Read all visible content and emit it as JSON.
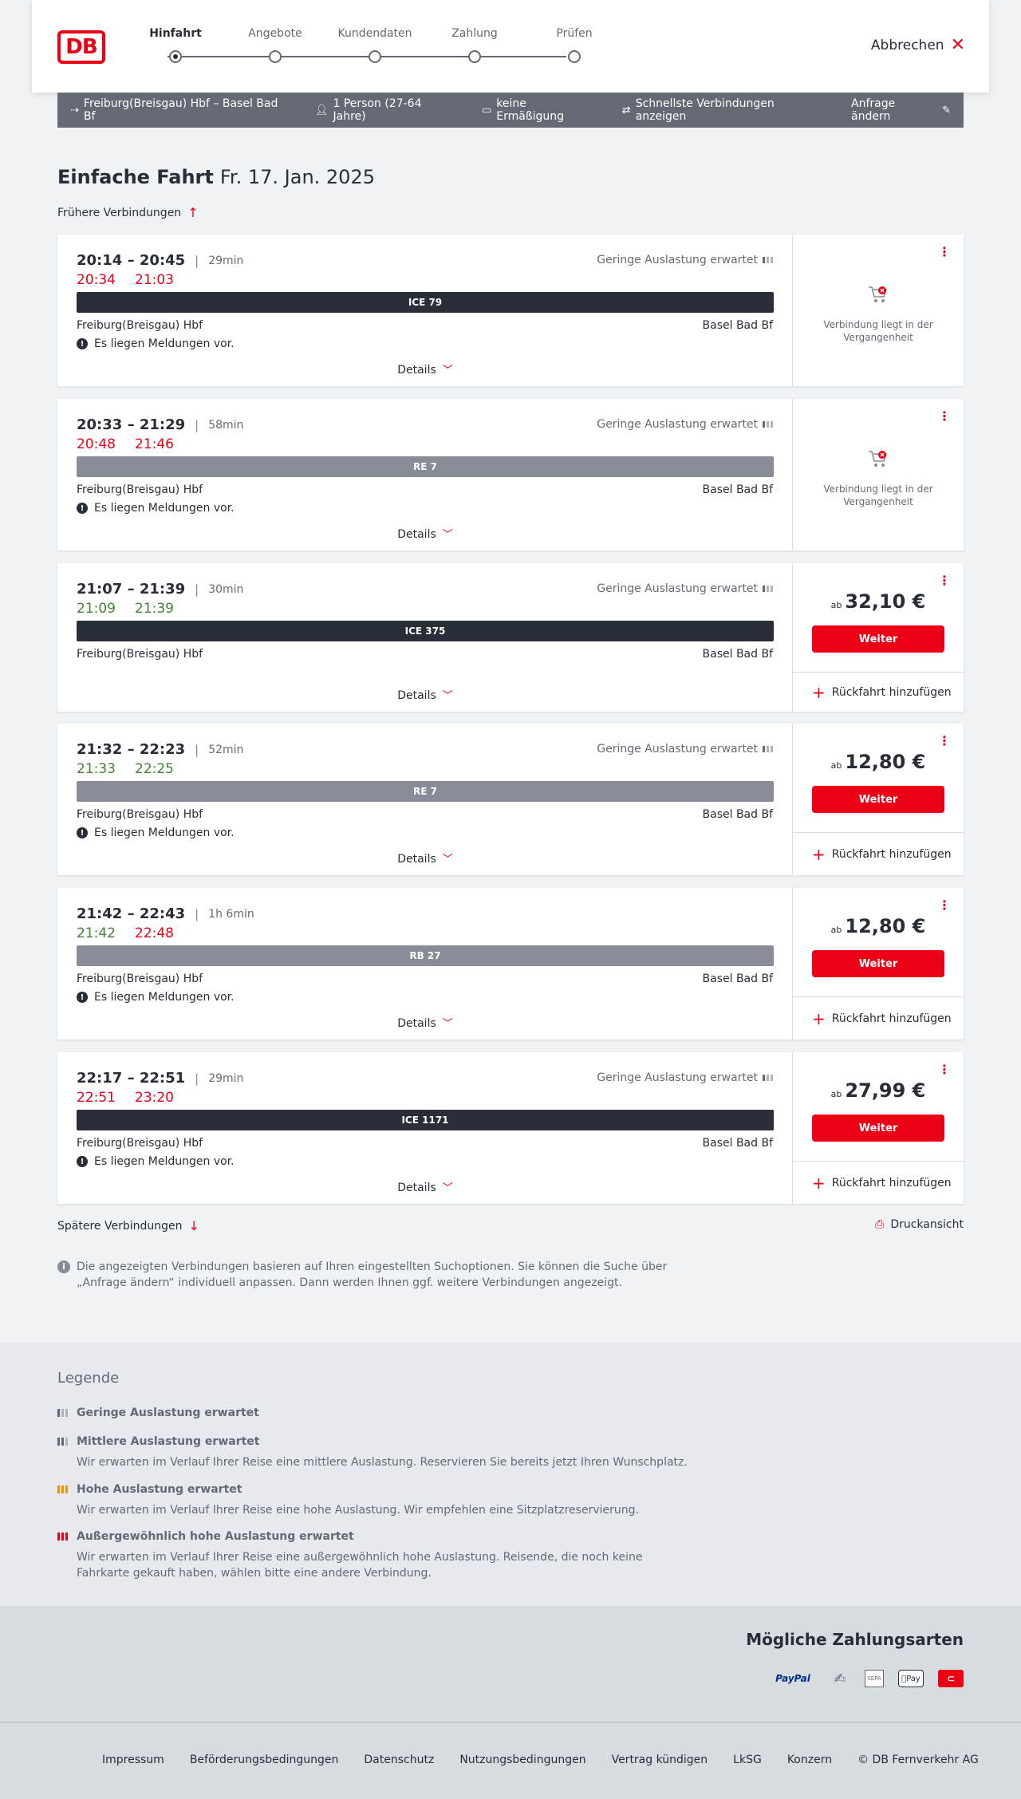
{
  "header": {
    "logo": "DB",
    "steps": [
      {
        "label": "Hinfahrt",
        "active": true
      },
      {
        "label": "Angebote",
        "active": false
      },
      {
        "label": "Kundendaten",
        "active": false
      },
      {
        "label": "Zahlung",
        "active": false
      },
      {
        "label": "Prüfen",
        "active": false
      }
    ],
    "cancel_label": "Abbrechen"
  },
  "summary": {
    "route": "Freiburg(Breisgau) Hbf – Basel Bad Bf",
    "travellers": "1 Person (27-64 Jahre)",
    "discount": "keine Ermäßigung",
    "fastest": "Schnellste Verbindungen anzeigen",
    "change": "Anfrage ändern"
  },
  "heading": {
    "title": "Einfache Fahrt",
    "date": "Fr. 17. Jan. 2025",
    "earlier": "Frühere Verbindungen",
    "later": "Spätere Verbindungen",
    "print": "Druckansicht"
  },
  "connections": [
    {
      "times": "20:14 – 20:45",
      "duration": "29min",
      "rt_dep": "20:34",
      "rt_arr": "21:03",
      "dep_status": "late",
      "arr_status": "late",
      "load": "Geringe Auslastung erwartet",
      "train": "ICE 79",
      "train_type": "ice",
      "from": "Freiburg(Breisgau) Hbf",
      "to": "Basel Bad Bf",
      "notice": "Es liegen Meldungen vor.",
      "details": "Details",
      "past": "Verbindung liegt in der Vergangenheit"
    },
    {
      "times": "20:33 – 21:29",
      "duration": "58min",
      "rt_dep": "20:48",
      "rt_arr": "21:46",
      "dep_status": "late",
      "arr_status": "late",
      "load": "Geringe Auslastung erwartet",
      "train": "RE 7",
      "train_type": "reg",
      "from": "Freiburg(Breisgau) Hbf",
      "to": "Basel Bad Bf",
      "notice": "Es liegen Meldungen vor.",
      "details": "Details",
      "past": "Verbindung liegt in der Vergangenheit"
    },
    {
      "times": "21:07 – 21:39",
      "duration": "30min",
      "rt_dep": "21:09",
      "rt_arr": "21:39",
      "dep_status": "ontime",
      "arr_status": "ontime",
      "load": "Geringe Auslastung erwartet",
      "train": "ICE 375",
      "train_type": "ice",
      "from": "Freiburg(Breisgau) Hbf",
      "to": "Basel Bad Bf",
      "details": "Details",
      "price_prefix": "ab",
      "price": "32,10 €",
      "button": "Weiter",
      "return": "Rückfahrt hinzufügen"
    },
    {
      "times": "21:32 – 22:23",
      "duration": "52min",
      "rt_dep": "21:33",
      "rt_arr": "22:25",
      "dep_status": "ontime",
      "arr_status": "ontime",
      "load": "Geringe Auslastung erwartet",
      "train": "RE 7",
      "train_type": "reg",
      "from": "Freiburg(Breisgau) Hbf",
      "to": "Basel Bad Bf",
      "notice": "Es liegen Meldungen vor.",
      "details": "Details",
      "price_prefix": "ab",
      "price": "12,80 €",
      "button": "Weiter",
      "return": "Rückfahrt hinzufügen"
    },
    {
      "times": "21:42 – 22:43",
      "duration": "1h 6min",
      "rt_dep": "21:42",
      "rt_arr": "22:48",
      "dep_status": "ontime",
      "arr_status": "late",
      "load": "",
      "train": "RB 27",
      "train_type": "reg",
      "from": "Freiburg(Breisgau) Hbf",
      "to": "Basel Bad Bf",
      "notice": "Es liegen Meldungen vor.",
      "details": "Details",
      "price_prefix": "ab",
      "price": "12,80 €",
      "button": "Weiter",
      "return": "Rückfahrt hinzufügen"
    },
    {
      "times": "22:17 – 22:51",
      "duration": "29min",
      "rt_dep": "22:51",
      "rt_arr": "23:20",
      "dep_status": "late",
      "arr_status": "late",
      "load": "Geringe Auslastung erwartet",
      "train": "ICE 1171",
      "train_type": "ice",
      "from": "Freiburg(Breisgau) Hbf",
      "to": "Basel Bad Bf",
      "notice": "Es liegen Meldungen vor.",
      "details": "Details",
      "price_prefix": "ab",
      "price": "27,99 €",
      "button": "Weiter",
      "return": "Rückfahrt hinzufügen"
    }
  ],
  "info_text": "Die angezeigten Verbindungen basieren auf Ihren eingestellten Suchoptionen. Sie können die Suche über „Anfrage ändern“ individuell anpassen. Dann werden Ihnen ggf. weitere Verbindungen angezeigt.",
  "legend": {
    "title": "Legende",
    "items": [
      {
        "title": "Geringe Auslastung erwartet",
        "desc": ""
      },
      {
        "title": "Mittlere Auslastung erwartet",
        "desc": "Wir erwarten im Verlauf Ihrer Reise eine mittlere Auslastung. Reservieren Sie bereits jetzt Ihren Wunschplatz."
      },
      {
        "title": "Hohe Auslastung erwartet",
        "desc": "Wir erwarten im Verlauf Ihrer Reise eine hohe Auslastung. Wir empfehlen eine Sitzplatzreservierung."
      },
      {
        "title": "Außergewöhnlich hohe Auslastung erwartet",
        "desc": "Wir erwarten im Verlauf Ihrer Reise eine außergewöhnlich hohe Auslastung. Reisende, die noch keine Fahrkarte gekauft haben, wählen bitte eine andere Verbindung."
      }
    ]
  },
  "payment": {
    "title": "Mögliche Zahlungsarten",
    "paypal": "PayPal",
    "sepa": "SEPA",
    "applepay": "Pay"
  },
  "footer": {
    "links": [
      "Impressum",
      "Beförderungsbedingungen",
      "Datenschutz",
      "Nutzungsbedingungen",
      "Vertrag kündigen",
      "LkSG",
      "Konzern",
      "© DB Fernverkehr AG"
    ]
  },
  "colors": {
    "accent": "#ec0016",
    "ontime": "#408335",
    "dark": "#282d37",
    "summary_bg": "#646973"
  }
}
